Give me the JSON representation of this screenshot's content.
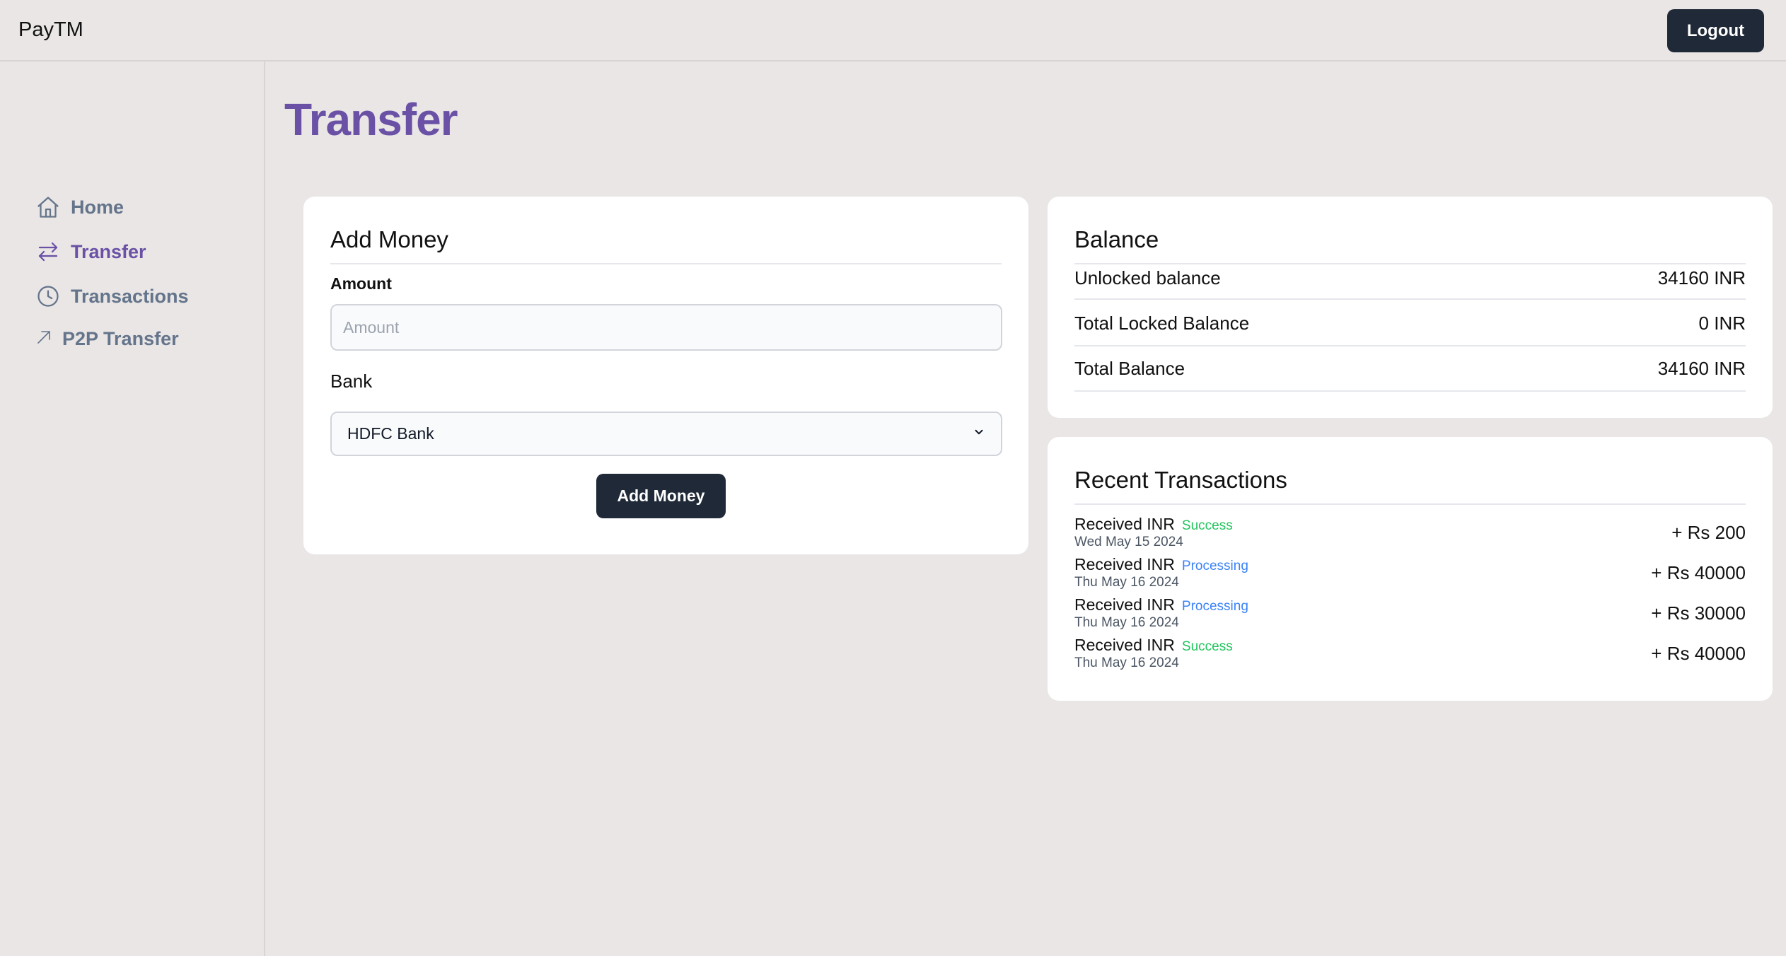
{
  "header": {
    "brand": "PayTM",
    "logout_label": "Logout"
  },
  "sidebar": {
    "items": [
      {
        "label": "Home",
        "icon": "home-icon",
        "active": false
      },
      {
        "label": "Transfer",
        "icon": "transfer-icon",
        "active": true
      },
      {
        "label": "Transactions",
        "icon": "clock-icon",
        "active": false
      },
      {
        "label": "P2P Transfer",
        "icon": "arrow-up-right-icon",
        "active": false
      }
    ]
  },
  "page": {
    "title": "Transfer"
  },
  "add_money": {
    "title": "Add Money",
    "amount_label": "Amount",
    "amount_placeholder": "Amount",
    "amount_value": "",
    "bank_label": "Bank",
    "bank_selected": "HDFC Bank",
    "submit_label": "Add Money"
  },
  "balance": {
    "title": "Balance",
    "rows": [
      {
        "label": "Unlocked balance",
        "value": "34160 INR"
      },
      {
        "label": "Total Locked Balance",
        "value": "0 INR"
      },
      {
        "label": "Total Balance",
        "value": "34160 INR"
      }
    ]
  },
  "recent_transactions": {
    "title": "Recent Transactions",
    "items": [
      {
        "title": "Received INR",
        "status": "Success",
        "status_type": "success",
        "date": "Wed May 15 2024",
        "amount": "+ Rs 200"
      },
      {
        "title": "Received INR",
        "status": "Processing",
        "status_type": "processing",
        "date": "Thu May 16 2024",
        "amount": "+ Rs 40000"
      },
      {
        "title": "Received INR",
        "status": "Processing",
        "status_type": "processing",
        "date": "Thu May 16 2024",
        "amount": "+ Rs 30000"
      },
      {
        "title": "Received INR",
        "status": "Success",
        "status_type": "success",
        "date": "Thu May 16 2024",
        "amount": "+ Rs 40000"
      }
    ]
  },
  "colors": {
    "accent": "#6a51a6",
    "button_dark": "#1f2937",
    "status_success": "#22c55e",
    "status_processing": "#3b82f6",
    "background": "#e9e6e5"
  }
}
